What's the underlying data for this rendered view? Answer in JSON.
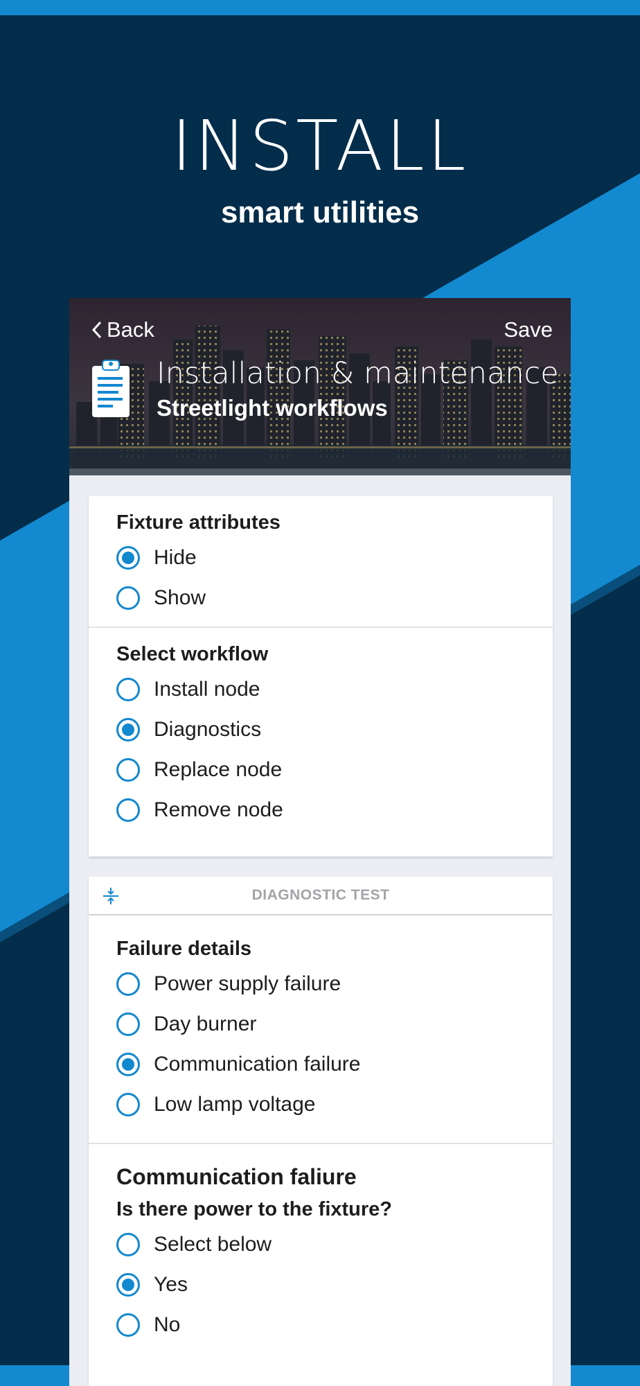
{
  "hero": {
    "title": "INSTALL",
    "subtitle": "smart utilities"
  },
  "colors": {
    "navy": "#032d4a",
    "blue": "#1288cf",
    "accent_line": "#138ad0"
  },
  "header": {
    "back_label": "Back",
    "save_label": "Save",
    "title": "Installation & maintenance",
    "subtitle": "Streetlight workflows",
    "icon": "clipboard-icon"
  },
  "fixture": {
    "title": "Fixture attributes",
    "options": [
      {
        "label": "Hide",
        "selected": true
      },
      {
        "label": "Show",
        "selected": false
      }
    ]
  },
  "workflow": {
    "title": "Select workflow",
    "options": [
      {
        "label": "Install node",
        "selected": false
      },
      {
        "label": "Diagnostics",
        "selected": true
      },
      {
        "label": "Replace node",
        "selected": false
      },
      {
        "label": "Remove node",
        "selected": false
      }
    ]
  },
  "diagnostic": {
    "label": "DIAGNOSTIC TEST",
    "icon": "collapse-icon"
  },
  "failure": {
    "title": "Failure details",
    "options": [
      {
        "label": "Power supply failure",
        "selected": false
      },
      {
        "label": "Day burner",
        "selected": false
      },
      {
        "label": "Communication failure",
        "selected": true
      },
      {
        "label": "Low lamp voltage",
        "selected": false
      }
    ]
  },
  "communication": {
    "title": "Communication faliure",
    "question": "Is there power to the fixture?",
    "options": [
      {
        "label": "Select below",
        "selected": false
      },
      {
        "label": "Yes",
        "selected": true
      },
      {
        "label": "No",
        "selected": false
      }
    ]
  }
}
